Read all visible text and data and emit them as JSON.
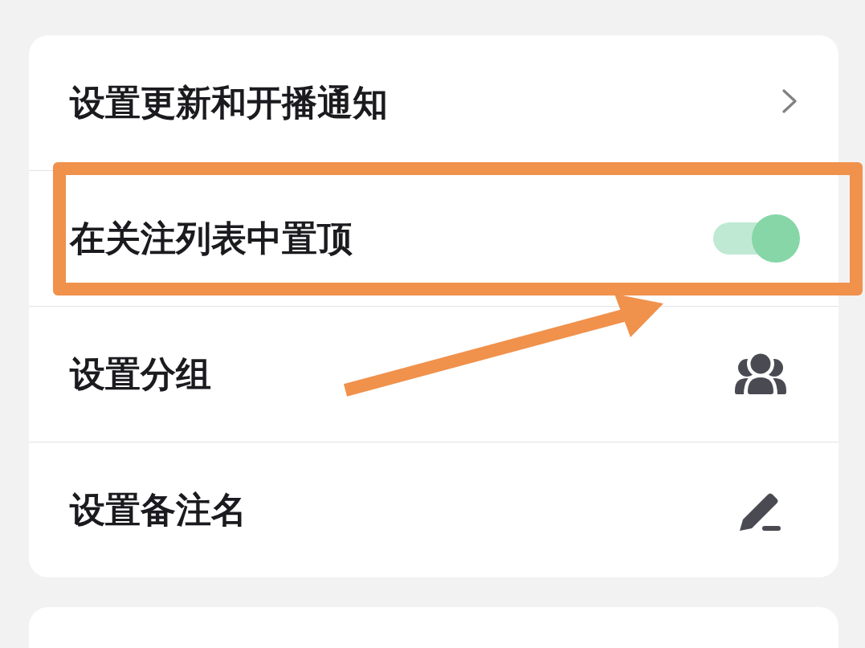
{
  "settings_card": {
    "rows": [
      {
        "kind": "link",
        "label": "设置更新和开播通知",
        "highlighted": false
      },
      {
        "kind": "toggle",
        "label": "在关注列表中置顶",
        "on": true,
        "highlighted": true
      },
      {
        "kind": "group",
        "label": "设置分组",
        "highlighted": false
      },
      {
        "kind": "edit",
        "label": "设置备注名",
        "highlighted": false
      }
    ]
  },
  "annotation_arrow": true
}
